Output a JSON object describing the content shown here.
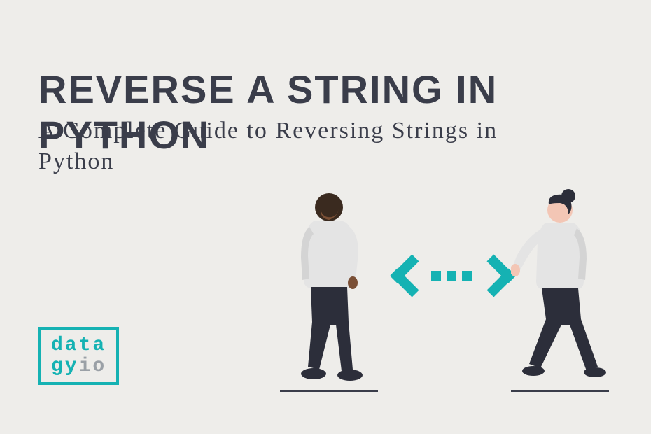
{
  "title": "REVERSE A STRING IN PYTHON",
  "subtitle": "A Complete Guide to Reversing Strings in Python",
  "logo": {
    "line1_teal": "data",
    "line2_teal": "gy",
    "line2_gray": "io"
  },
  "colors": {
    "accent": "#15b2b3",
    "text": "#3a3d4a",
    "background": "#eeedea"
  }
}
